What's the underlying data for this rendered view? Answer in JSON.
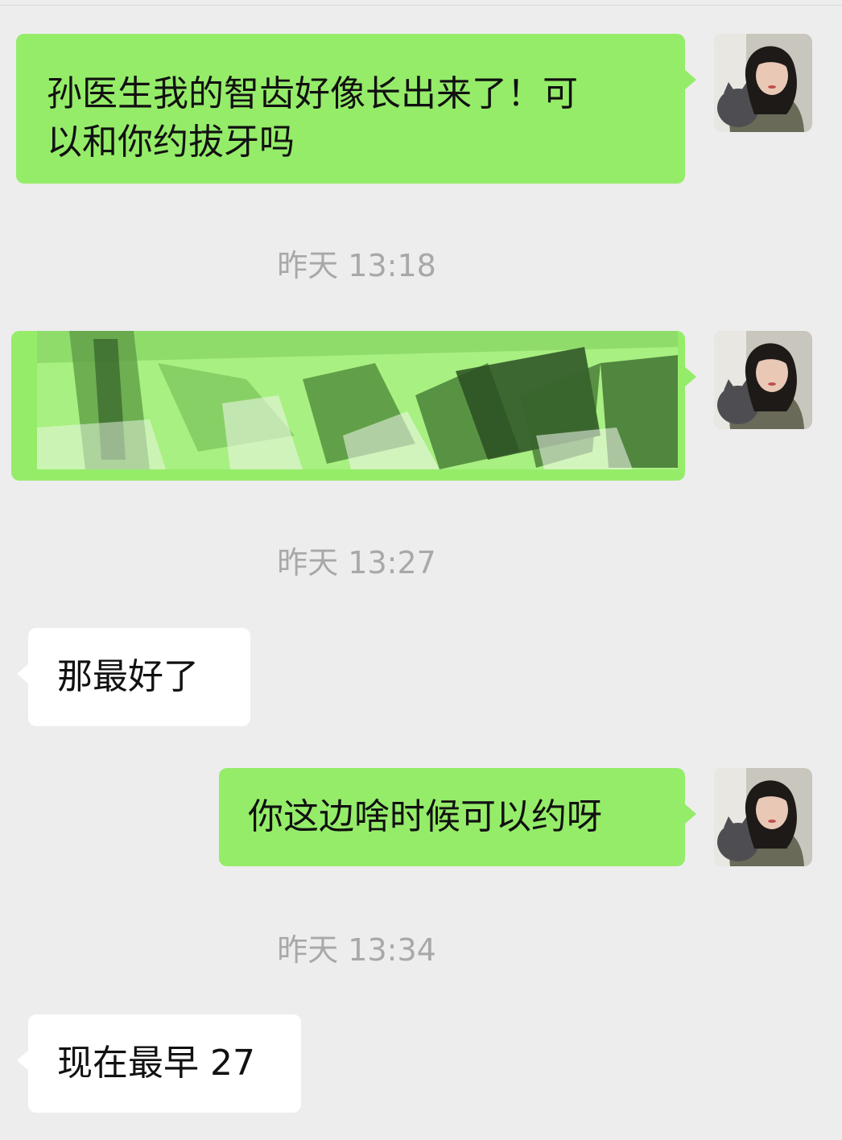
{
  "messages": [
    {
      "sender": "me",
      "type": "text",
      "text": "孙医生我的智齿好像长出来了！可以和你约拔牙吗"
    },
    {
      "type": "timestamp",
      "text": "昨天 13:18"
    },
    {
      "sender": "me",
      "type": "image",
      "content": "scribbled-redaction"
    },
    {
      "type": "timestamp",
      "text": "昨天 13:27"
    },
    {
      "sender": "other",
      "type": "text",
      "text": "那最好了"
    },
    {
      "sender": "me",
      "type": "text",
      "text": "你这边啥时候可以约呀"
    },
    {
      "type": "timestamp",
      "text": "昨天 13:34"
    },
    {
      "sender": "other",
      "type": "text",
      "text": "现在最早 27"
    }
  ],
  "lines": {
    "msg1_line1": "孙医生我的智齿好像长出来了！可",
    "msg1_line2": "以和你约拔牙吗"
  },
  "colors": {
    "background": "#ededed",
    "my_bubble": "#95ec69",
    "their_bubble": "#ffffff",
    "timestamp_text": "#a8a8a8"
  },
  "icons": {
    "avatar": "user-avatar-woman-with-cat"
  }
}
